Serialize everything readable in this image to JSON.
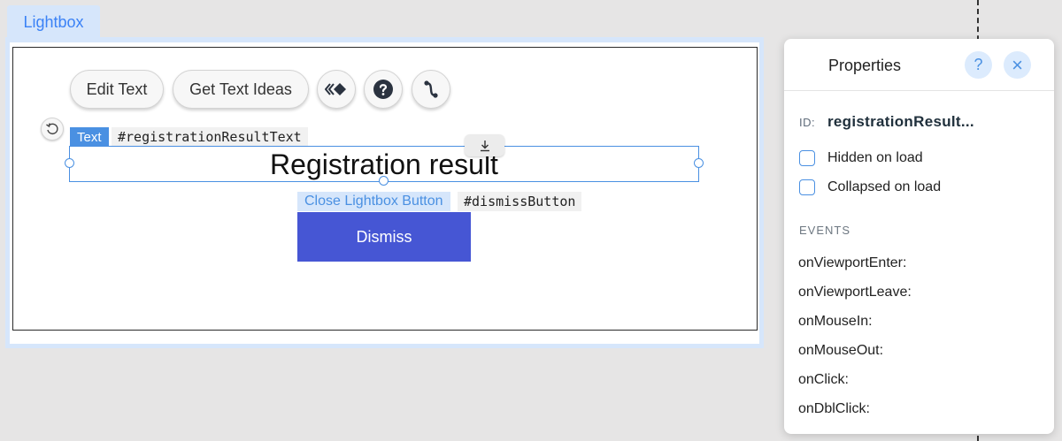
{
  "lightbox": {
    "tab_label": "Lightbox"
  },
  "toolbar": {
    "edit_text": "Edit Text",
    "get_text_ideas": "Get Text Ideas"
  },
  "element": {
    "type_label": "Text",
    "id": "#registrationResultText",
    "text": "Registration result"
  },
  "button_element": {
    "type_label": "Close Lightbox Button",
    "id": "#dismissButton",
    "label": "Dismiss",
    "color": "#4656d4"
  },
  "properties": {
    "title": "Properties",
    "help_glyph": "?",
    "close_glyph": "×",
    "id_label": "ID:",
    "id_value": "registrationResult...",
    "checkboxes": [
      {
        "label": "Hidden on load",
        "checked": false
      },
      {
        "label": "Collapsed on load",
        "checked": false
      }
    ],
    "events_header": "EVENTS",
    "events": [
      "onViewportEnter:",
      "onViewportLeave:",
      "onMouseIn:",
      "onMouseOut:",
      "onClick:",
      "onDblClick:"
    ]
  },
  "colors": {
    "accent": "#4a90e2",
    "canvas_bg": "#e6e5e5"
  }
}
